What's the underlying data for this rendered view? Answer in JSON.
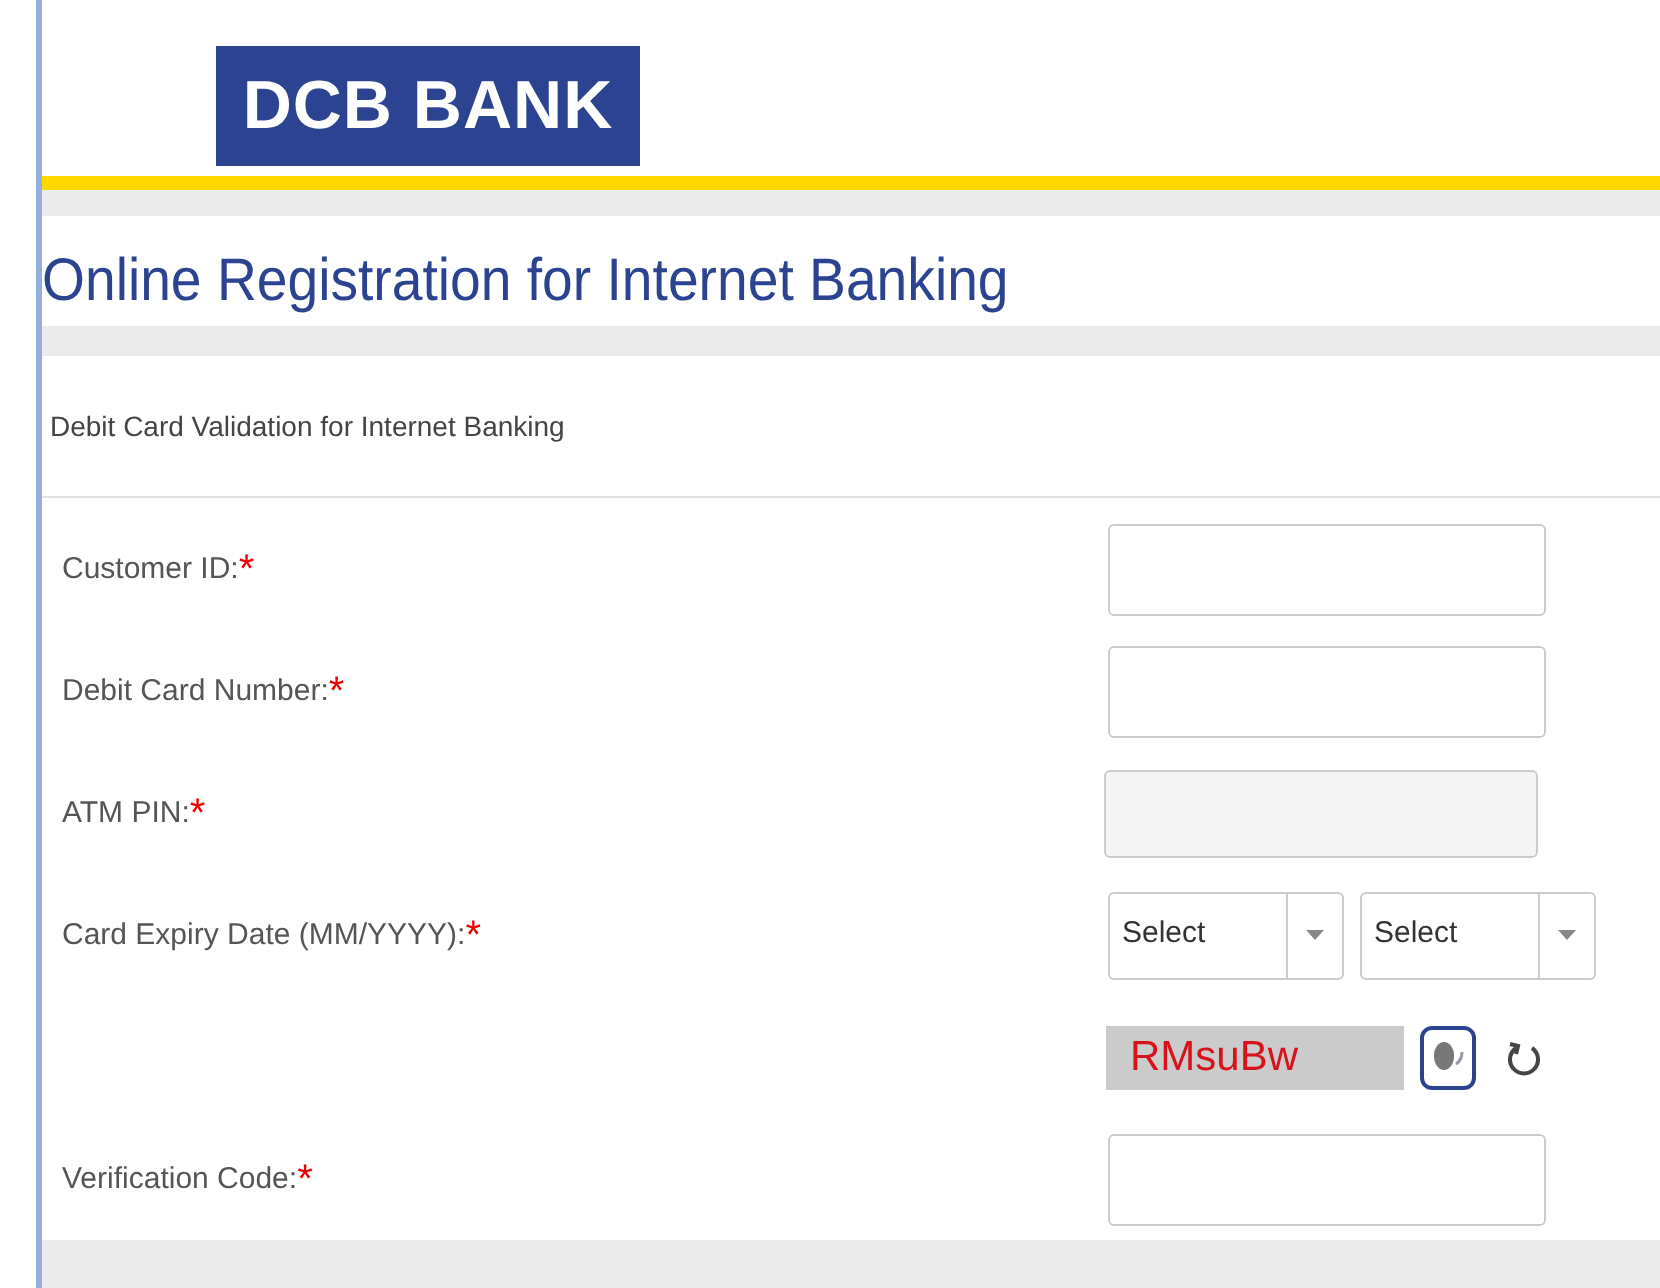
{
  "logo": {
    "text": "DCB BANK"
  },
  "title": "Online Registration for Internet Banking",
  "section": "Debit Card Validation for Internet Banking",
  "fields": [
    {
      "kind": "text",
      "label": "Customer ID:",
      "mark": "*",
      "disabled": false
    },
    {
      "kind": "text",
      "label": "Debit Card Number:",
      "mark": "*",
      "disabled": false
    },
    {
      "kind": "text",
      "label": "ATM PIN:",
      "mark": "*",
      "disabled": true
    },
    {
      "kind": "selects",
      "label": "Card Expiry Date (MM/YYYY):",
      "mark": "*",
      "selects": [
        "Select",
        "Select"
      ]
    },
    {
      "kind": "captcha",
      "code": "RMsuBw"
    },
    {
      "kind": "text",
      "label": "Verification Code:",
      "mark": "*",
      "disabled": false
    }
  ]
}
